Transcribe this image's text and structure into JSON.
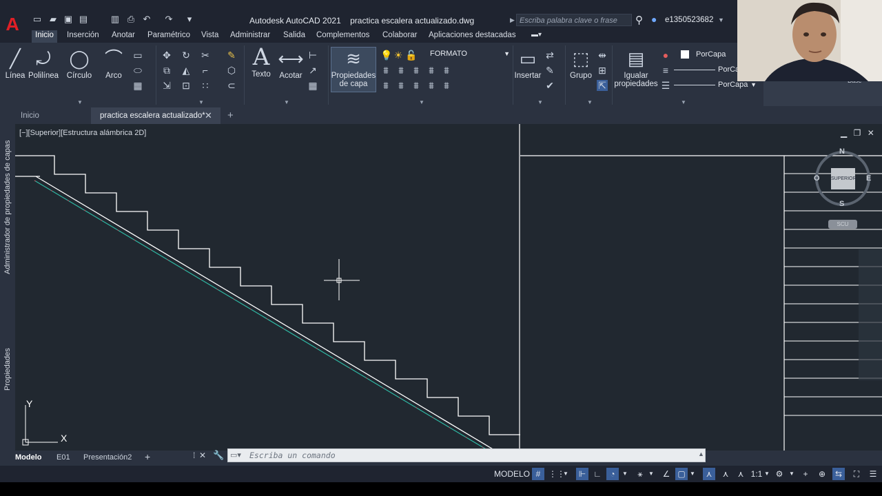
{
  "titlebar": {
    "app_name": "Autodesk AutoCAD 2021",
    "file_name": "practica escalera actualizado.dwg",
    "search_placeholder": "Escriba palabra clave o frase",
    "user": "e1350523682"
  },
  "menu_tabs": [
    "Inicio",
    "Inserción",
    "Anotar",
    "Paramétrico",
    "Vista",
    "Administrar",
    "Salida",
    "Complementos",
    "Colaborar",
    "Aplicaciones destacadas"
  ],
  "ribbon": {
    "draw": {
      "linea": "Línea",
      "polilinea": "Polilínea",
      "circulo": "Círculo",
      "arco": "Arco"
    },
    "annotation": {
      "texto": "Texto",
      "acotar": "Acotar"
    },
    "layers": {
      "propiedades_line1": "Propiedades",
      "propiedades_line2": "de capa",
      "current_layer": "FORMATO"
    },
    "block": {
      "insertar": "Insertar"
    },
    "groups": {
      "grupo": "Grupo"
    },
    "properties": {
      "igualar_line1": "Igualar",
      "igualar_line2": "propiedades",
      "color": "PorCapa",
      "linetype": "PorCapa",
      "lineweight": "PorCapa"
    },
    "base": "Base"
  },
  "file_tabs": {
    "home": "Inicio",
    "document": "practica escalera actualizado*"
  },
  "drawing": {
    "viewport_label": "[−][Superior][Estructura alámbrica 2D]",
    "palette_layers": "Administrador de propiedades de capas",
    "palette_props": "Propiedades",
    "viewcube": {
      "face": "SUPERIOR",
      "north": "N",
      "south": "S",
      "east": "E",
      "west": "O",
      "ucs": "SCU"
    },
    "ucs_x": "X",
    "ucs_y": "Y"
  },
  "layout_tabs": [
    "Modelo",
    "E01",
    "Presentación2"
  ],
  "command_line": {
    "placeholder": "Escriba un comando"
  },
  "statusbar": {
    "space": "MODELO",
    "scale": "1:1"
  }
}
